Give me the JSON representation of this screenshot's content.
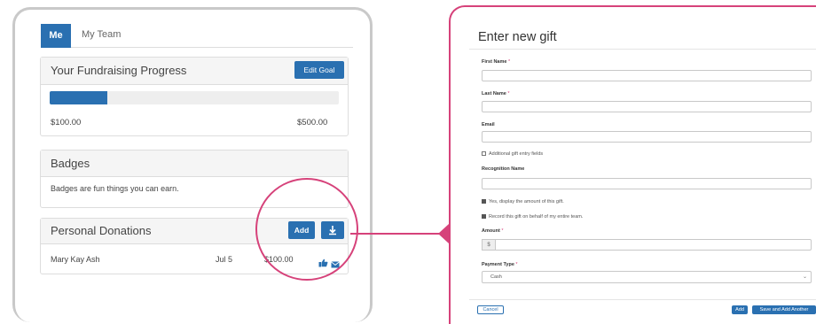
{
  "tabs": {
    "me": "Me",
    "my_team": "My Team"
  },
  "progress_panel": {
    "title": "Your Fundraising Progress",
    "edit_goal_label": "Edit Goal",
    "progress_fraction": 0.2,
    "raised": "$100.00",
    "goal": "$500.00"
  },
  "badges_panel": {
    "title": "Badges",
    "text": "Badges are fun things you can earn."
  },
  "donations_panel": {
    "title": "Personal Donations",
    "add_label": "Add",
    "download_icon": "download-icon",
    "row": {
      "name": "Mary Kay Ash",
      "date": "Jul 5",
      "amount": "$100.00",
      "icons": [
        "thumbs-up-icon",
        "envelope-icon"
      ]
    }
  },
  "form": {
    "title": "Enter new gift",
    "first_name_label": "First Name",
    "last_name_label": "Last Name",
    "email_label": "Email",
    "required_mark": "*",
    "additional_fields_label": "Additional gift entry fields",
    "recognition_name_label": "Recognition Name",
    "display_amount_label": "Yes, display the amount of this gift.",
    "entire_team_label": "Record this gift on behalf of my entire team.",
    "amount_label": "Amount",
    "currency_symbol": "$",
    "payment_type_label": "Payment Type",
    "payment_type_value": "Cash",
    "cancel_label": "Cancel",
    "add_label": "Add",
    "save_add_another_label": "Save and Add Another"
  },
  "colors": {
    "primary": "#2a70b1",
    "accent": "#d6427a"
  }
}
